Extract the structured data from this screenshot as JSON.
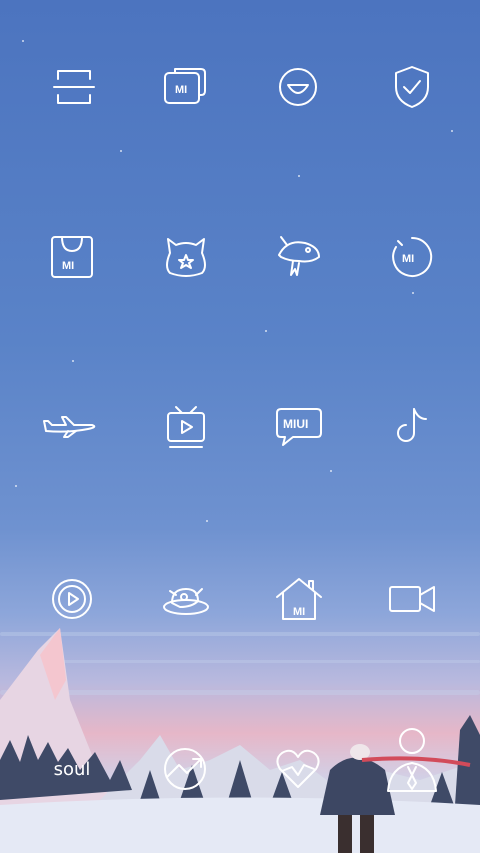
{
  "wallpaper": {
    "sky_top": "#4c74bf",
    "sky_horizon": "#e6b7c8",
    "snow": "#e9edf7"
  },
  "rows": [
    {
      "apps": [
        {
          "id": "scanner",
          "icon": "scanner-icon"
        },
        {
          "id": "mi-wallet",
          "icon": "wallet-icon",
          "text": "MI"
        },
        {
          "id": "smile",
          "icon": "smile-icon"
        },
        {
          "id": "security",
          "icon": "shield-check-icon"
        }
      ]
    },
    {
      "apps": [
        {
          "id": "mi-store",
          "icon": "shopping-bag-icon",
          "text": "MI"
        },
        {
          "id": "mi-community",
          "icon": "mi-bunny-icon"
        },
        {
          "id": "jd-shopping",
          "icon": "fish-icon"
        },
        {
          "id": "mi-fit",
          "icon": "mi-ring-icon",
          "text": "MI"
        }
      ]
    },
    {
      "apps": [
        {
          "id": "flights",
          "icon": "airplane-icon"
        },
        {
          "id": "mi-video",
          "icon": "tv-play-icon"
        },
        {
          "id": "miui-forum",
          "icon": "miui-bubble-icon",
          "text": "MIUI"
        },
        {
          "id": "tiktok",
          "icon": "tiktok-icon"
        }
      ]
    },
    {
      "apps": [
        {
          "id": "music-player",
          "icon": "play-circle-icon"
        },
        {
          "id": "food",
          "icon": "roast-chicken-icon"
        },
        {
          "id": "mi-home",
          "icon": "house-icon",
          "text": "MI"
        },
        {
          "id": "video-call",
          "icon": "camcorder-icon"
        }
      ]
    }
  ],
  "dock": [
    {
      "id": "soul",
      "label": "soul"
    },
    {
      "id": "trend",
      "icon": "trend-chart-icon"
    },
    {
      "id": "health",
      "icon": "heart-pulse-icon"
    },
    {
      "id": "contacts",
      "icon": "person-tie-icon"
    }
  ]
}
